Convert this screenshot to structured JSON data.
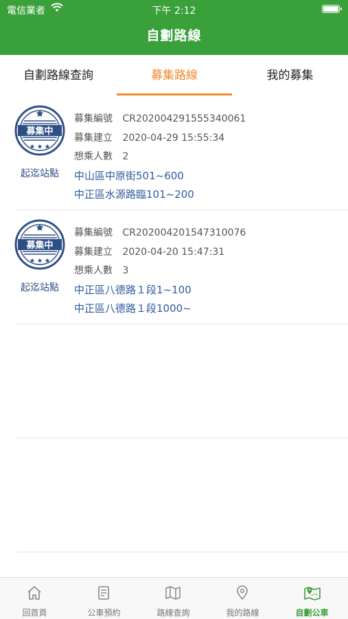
{
  "status_bar": {
    "carrier": "電信業者",
    "time": "下午 2:12"
  },
  "nav": {
    "title": "自劃路線"
  },
  "tabs": [
    {
      "label": "自劃路線查詢",
      "active": false
    },
    {
      "label": "募集路線",
      "active": true
    },
    {
      "label": "我的募集",
      "active": false
    }
  ],
  "labels": {
    "recruit_id": "募集編號",
    "created": "募集建立",
    "riders": "想乘人數",
    "stops_link": "起迄站點",
    "stamp_text": "募集中"
  },
  "cards": [
    {
      "id": "CR202004291555340061",
      "created": "2020-04-29 15:55:34",
      "riders": "2",
      "from": "中山區中原街501~600",
      "to": "中正區水源路臨101~200"
    },
    {
      "id": "CR202004201547310076",
      "created": "2020-04-20 15:47:31",
      "riders": "3",
      "from": "中正區八德路１段1~100",
      "to": "中正區八德路１段1000~"
    }
  ],
  "bottom_nav": [
    {
      "label": "回首頁",
      "icon": "home-icon"
    },
    {
      "label": "公車預約",
      "icon": "ticket-icon"
    },
    {
      "label": "路線查詢",
      "icon": "map-icon"
    },
    {
      "label": "我的路線",
      "icon": "location-pin-icon"
    },
    {
      "label": "自劃公車",
      "icon": "route-map-icon",
      "active": true
    }
  ],
  "colors": {
    "brand_green": "#3aa03a",
    "accent_orange": "#f0892f",
    "link_blue": "#2e4f86"
  }
}
